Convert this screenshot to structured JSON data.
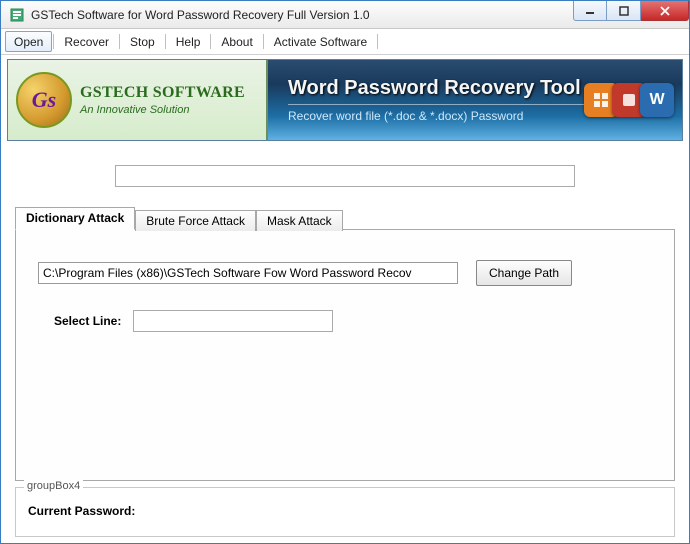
{
  "window": {
    "title": "GSTech Software  for Word Password Recovery Full Version 1.0"
  },
  "menu": {
    "items": [
      "Open",
      "Recover",
      "Stop",
      "Help",
      "About",
      "Activate Software"
    ],
    "active_index": 0
  },
  "banner": {
    "logo_text": "Gs",
    "brand_name": "GSTECH SOFTWARE",
    "brand_tag": "An Innovative Solution",
    "title": "Word Password Recovery Tool",
    "subtitle": "Recover word file (*.doc & *.docx) Password",
    "right_icons": [
      "office-icon",
      "powerpoint-icon",
      "word-icon"
    ],
    "word_icon_glyph": "W"
  },
  "main": {
    "top_input_value": "",
    "tabs": [
      {
        "label": "Dictionary Attack",
        "active": true
      },
      {
        "label": "Brute Force Attack",
        "active": false
      },
      {
        "label": "Mask Attack",
        "active": false
      }
    ],
    "path_value": "C:\\Program Files (x86)\\GSTech Software Fow Word Password Recov",
    "change_path_label": "Change Path",
    "select_line_label": "Select Line:",
    "select_line_value": ""
  },
  "footer": {
    "group_label": "groupBox4",
    "current_password_label": "Current Password:",
    "current_password_value": ""
  }
}
